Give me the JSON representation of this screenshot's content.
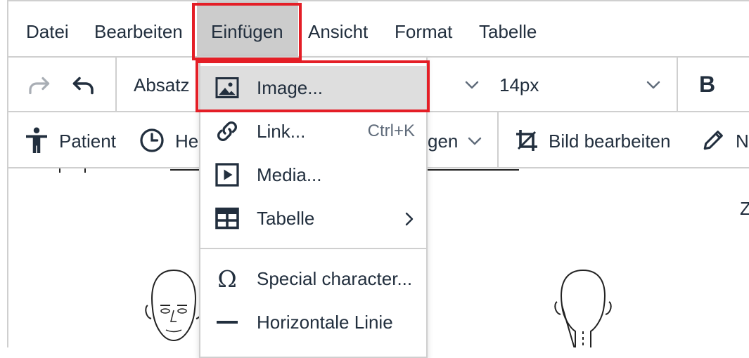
{
  "menubar": {
    "items": [
      "Datei",
      "Bearbeiten",
      "Einfügen",
      "Ansicht",
      "Format",
      "Tabelle"
    ]
  },
  "toolbar1": {
    "block_format": "Absatz",
    "font_size": "14px",
    "bold_label": "B"
  },
  "toolbar2": {
    "patient": "Patient",
    "history_partial": "He",
    "hidden_partial": "gen",
    "edit_image": "Bild bearbeiten",
    "next_partial": "N"
  },
  "dropdown": {
    "items": [
      {
        "label": "Image...",
        "shortcut": "",
        "icon": "image-icon"
      },
      {
        "label": "Link...",
        "shortcut": "Ctrl+K",
        "icon": "link-icon"
      },
      {
        "label": "Media...",
        "shortcut": "",
        "icon": "media-icon"
      },
      {
        "label": "Tabelle",
        "shortcut": "",
        "icon": "table-icon"
      },
      {
        "label": "Special character...",
        "shortcut": "",
        "icon": "omega-icon"
      },
      {
        "label": "Horizontale Linie",
        "shortcut": "",
        "icon": "horizontal-line-icon"
      }
    ]
  },
  "document": {
    "partial_char": "Z"
  },
  "colors": {
    "highlight": "#e41e26",
    "active_menu_bg": "#cccccc",
    "selected_item_bg": "#dedede",
    "text": "#222f3e"
  }
}
